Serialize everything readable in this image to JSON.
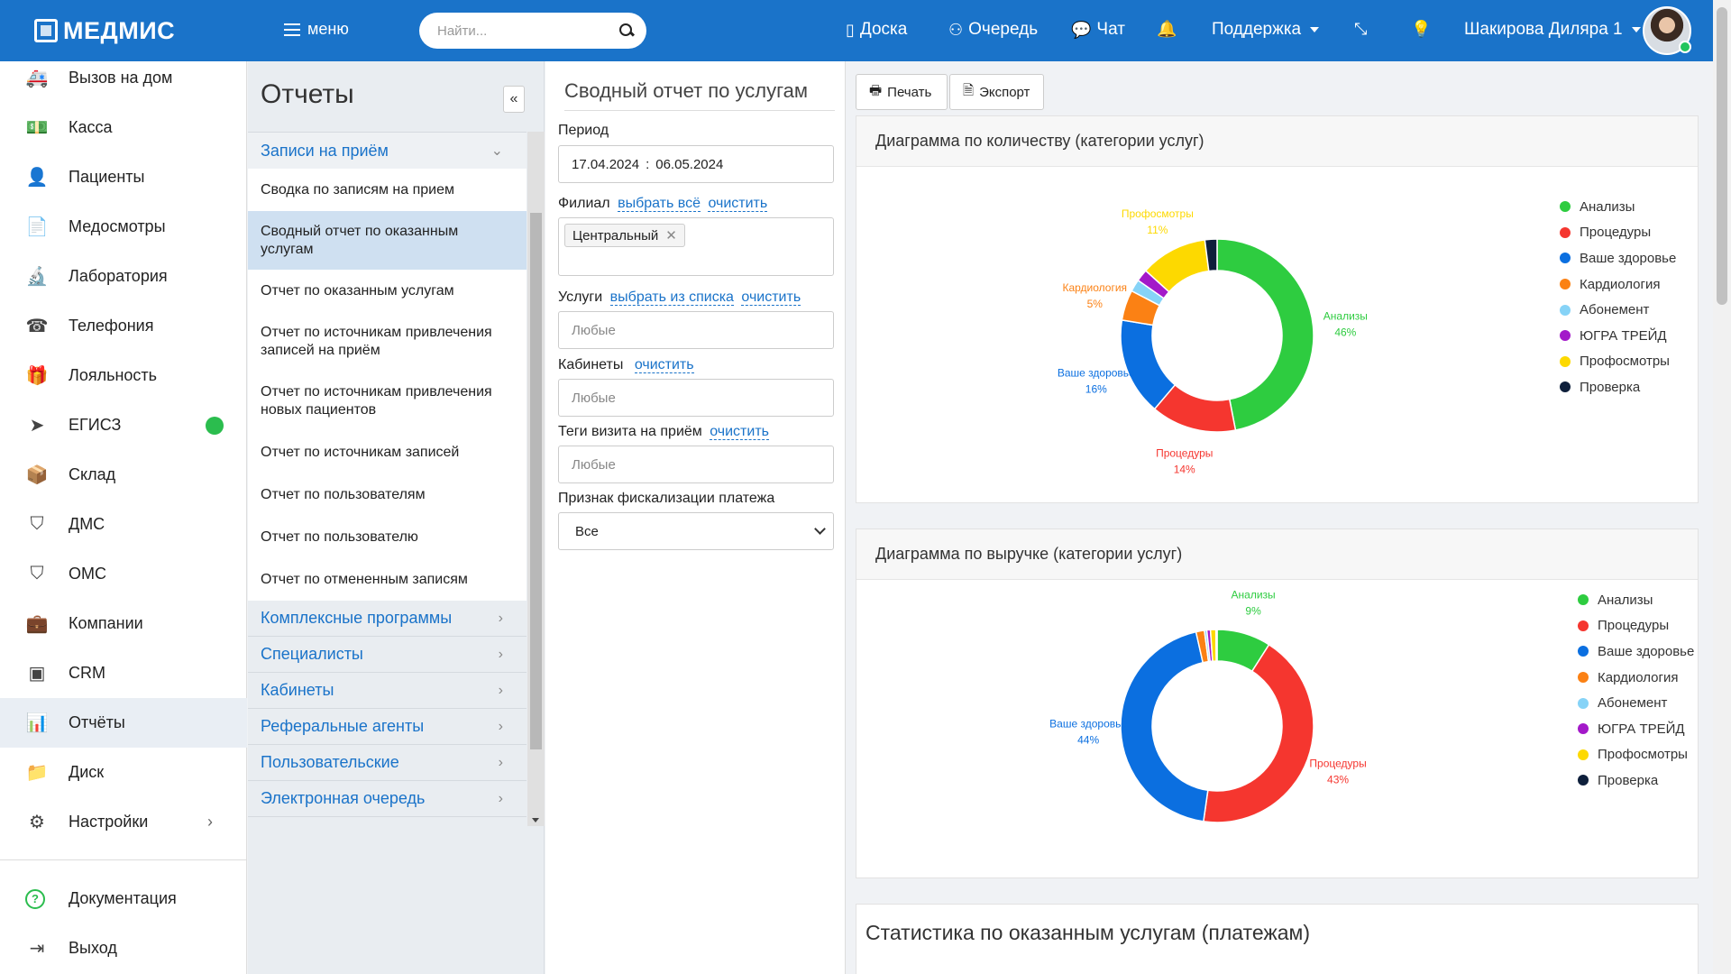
{
  "header": {
    "logo": "МЕДМИС",
    "menu_label": "меню",
    "search_placeholder": "Найти...",
    "nav": {
      "board": "Доска",
      "queue": "Очередь",
      "chat": "Чат",
      "support": "Поддержка",
      "user": "Шакирова Диляра 1"
    },
    "icons": [
      "menu-icon",
      "search-icon",
      "board-icon",
      "queue-icon",
      "chat-icon",
      "bell-icon",
      "collapse-icon",
      "bulb-icon"
    ]
  },
  "sidebar": {
    "items": [
      {
        "label": "Вызов на дом",
        "icon": "ambulance-icon"
      },
      {
        "label": "Касса",
        "icon": "cash-icon"
      },
      {
        "label": "Пациенты",
        "icon": "patients-icon"
      },
      {
        "label": "Медосмотры",
        "icon": "document-icon"
      },
      {
        "label": "Лаборатория",
        "icon": "microscope-icon"
      },
      {
        "label": "Телефония",
        "icon": "phone-icon"
      },
      {
        "label": "Лояльность",
        "icon": "gift-icon"
      },
      {
        "label": "ЕГИСЗ",
        "icon": "send-icon"
      },
      {
        "label": "Склад",
        "icon": "box-icon"
      },
      {
        "label": "ДМС",
        "icon": "shield-icon"
      },
      {
        "label": "ОМС",
        "icon": "shield-icon"
      },
      {
        "label": "Компании",
        "icon": "briefcase-icon"
      },
      {
        "label": "CRM",
        "icon": "crm-icon"
      },
      {
        "label": "Отчёты",
        "icon": "chart-icon"
      },
      {
        "label": "Диск",
        "icon": "folder-icon"
      },
      {
        "label": "Настройки",
        "icon": "gear-icon"
      }
    ],
    "bottom": [
      {
        "label": "Документация",
        "icon": "help-icon"
      },
      {
        "label": "Выход",
        "icon": "logout-icon"
      }
    ],
    "active": "Отчёты",
    "egisz_status_color": "#2bbd4e"
  },
  "reports_menu": {
    "title": "Отчеты",
    "open_group": "Записи на приём",
    "sub_items": [
      "Сводка по записям на прием",
      "Сводный отчет по оказанным услугам",
      "Отчет по оказанным услугам",
      "Отчет по источникам привлечения записей на приём",
      "Отчет по источникам привлечения новых пациентов",
      "Отчет по источникам записей",
      "Отчет по пользователям",
      "Отчет по пользователю",
      "Отчет по отмененным записям"
    ],
    "active_sub": "Сводный отчет по оказанным услугам",
    "groups": [
      "Комплексные программы",
      "Специалисты",
      "Кабинеты",
      "Реферальные агенты",
      "Пользовательские",
      "Электронная очередь"
    ]
  },
  "filters": {
    "title": "Сводный отчет по услугам",
    "period_label": "Период",
    "period_from": "17.04.2024",
    "period_sep": ":",
    "period_to": "06.05.2024",
    "branch_label": "Филиал",
    "select_all": "выбрать всё",
    "clear": "очистить",
    "branch_tag": "Центральный",
    "services_label": "Услуги",
    "select_from_list": "выбрать из списка",
    "any": "Любые",
    "rooms_label": "Кабинеты",
    "tags_label": "Теги визита на приём",
    "fiscal_label": "Признак фискализации платежа",
    "fiscal_value": "Все"
  },
  "actions": {
    "print": "Печать",
    "export": "Экспорт"
  },
  "chart_data": [
    {
      "type": "pie",
      "title": "Диаграмма по количеству (категории услуг)",
      "categories": [
        "Анализы",
        "Процедуры",
        "Ваше здоровье",
        "Кардиология",
        "Абонемент",
        "ЮГРА ТРЕЙД",
        "Профосмотры",
        "Проверка"
      ],
      "values": [
        46,
        14,
        16,
        5,
        2,
        2,
        11,
        2
      ],
      "colors": [
        "#2ecc40",
        "#f5362f",
        "#0b6fe0",
        "#fb8114",
        "#86d3f7",
        "#a319c9",
        "#fdd900",
        "#0e1f3b"
      ],
      "labels_shown": [
        {
          "name": "Анализы",
          "pct": "46%"
        },
        {
          "name": "Процедуры",
          "pct": "14%"
        },
        {
          "name": "Ваше здоровье",
          "pct": "16%"
        },
        {
          "name": "Кардиология",
          "pct": "5%"
        },
        {
          "name": "Профосмотры",
          "pct": "11%"
        }
      ],
      "legend_position": "right"
    },
    {
      "type": "pie",
      "title": "Диаграмма по выручке (категории услуг)",
      "categories": [
        "Анализы",
        "Процедуры",
        "Ваше здоровье",
        "Кардиология",
        "Абонемент",
        "ЮГРА ТРЕЙД",
        "Профосмотры",
        "Проверка"
      ],
      "values": [
        9,
        43,
        44,
        1.4,
        0.4,
        0.6,
        0.9,
        0.2
      ],
      "colors": [
        "#2ecc40",
        "#f5362f",
        "#0b6fe0",
        "#fb8114",
        "#86d3f7",
        "#a319c9",
        "#fdd900",
        "#0e1f3b"
      ],
      "labels_shown": [
        {
          "name": "Анализы",
          "pct": "9%"
        },
        {
          "name": "Процедуры",
          "pct": "43%"
        },
        {
          "name": "Ваше здоровье",
          "pct": "44%"
        }
      ],
      "legend_position": "right"
    }
  ],
  "stats_section": {
    "title": "Статистика по оказанным услугам (платежам)"
  }
}
